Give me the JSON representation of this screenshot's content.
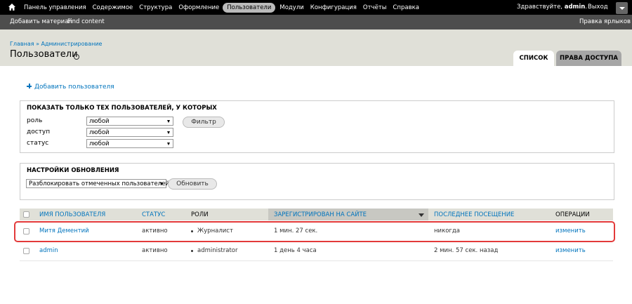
{
  "toolbar": {
    "menu": [
      "Панель управления",
      "Содержимое",
      "Структура",
      "Оформление",
      "Пользователи",
      "Модули",
      "Конфигурация",
      "Отчёты",
      "Справка"
    ],
    "active_index": 4,
    "greeting_prefix": "Здравствуйте, ",
    "username": "admin",
    "greeting_suffix": ".",
    "logout": "Выход"
  },
  "shortcuts": {
    "items": [
      "Добавить материал",
      "Find content"
    ],
    "edit": "Правка ярлыков"
  },
  "breadcrumb": "Главная » Администрирование",
  "page_title": "Пользователи",
  "tabs": {
    "list": "Список",
    "permissions": "Права доступа"
  },
  "add_user": "Добавить пользователя",
  "filter": {
    "title": "Показать только тех пользователей, у которых",
    "rows": [
      {
        "label": "роль",
        "value": "любой"
      },
      {
        "label": "доступ",
        "value": "любой"
      },
      {
        "label": "статус",
        "value": "любой"
      }
    ],
    "button": "Фильтр"
  },
  "update": {
    "title": "Настройки обновления",
    "select_value": "Разблокировать отмеченных пользователей",
    "button": "Обновить"
  },
  "table": {
    "headers": [
      "Имя пользователя",
      "Статус",
      "Роли",
      "Зарегистрирован на сайте",
      "Последнее посещение",
      "Операции"
    ],
    "rows": [
      {
        "name": "Митя Дементий",
        "status": "активно",
        "role": "Журналист",
        "registered": "1 мин. 27 сек.",
        "last_visit": "никогда",
        "op": "изменить"
      },
      {
        "name": "admin",
        "status": "активно",
        "role": "administrator",
        "registered": "1 день 4 часа",
        "last_visit": "2 мин. 57 сек. назад",
        "op": "изменить"
      }
    ]
  },
  "colors": {
    "link": "#0074bd",
    "highlight": "#e33a3a",
    "topbar": "#000000",
    "shortcut_bar": "#4d4d4d"
  }
}
